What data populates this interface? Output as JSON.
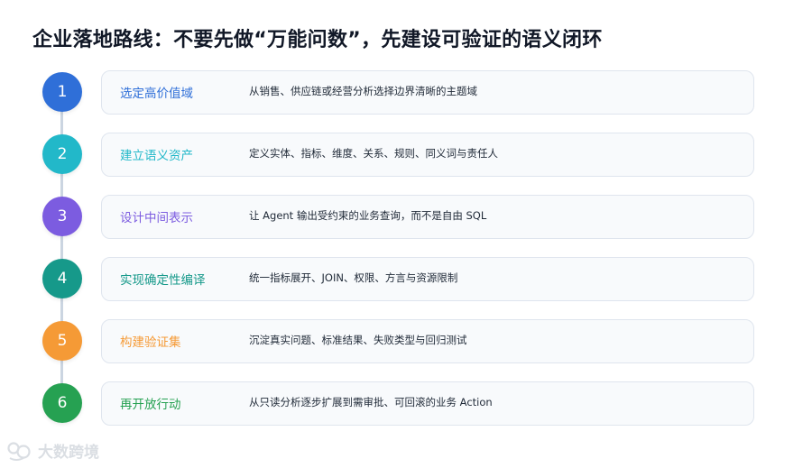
{
  "title": "企业落地路线：不要先做“万能问数”，先建设可验证的语义闭环",
  "steps": [
    {
      "number": "1",
      "title": "选定高价值域",
      "description": "从销售、供应链或经营分析选择边界清晰的主题域",
      "color": "#2f6fd8"
    },
    {
      "number": "2",
      "title": "建立语义资产",
      "description": "定义实体、指标、维度、关系、规则、同义词与责任人",
      "color": "#22b8c9"
    },
    {
      "number": "3",
      "title": "设计中间表示",
      "description": "让 Agent 输出受约束的业务查询，而不是自由 SQL",
      "color": "#7c5ce0"
    },
    {
      "number": "4",
      "title": "实现确定性编译",
      "description": "统一指标展开、JOIN、权限、方言与资源限制",
      "color": "#16998a"
    },
    {
      "number": "5",
      "title": "构建验证集",
      "description": "沉淀真实问题、标准结果、失败类型与回归测试",
      "color": "#f59a36"
    },
    {
      "number": "6",
      "title": "再开放行动",
      "description": "从只读分析逐步扩展到需审批、可回滚的业务 Action",
      "color": "#26a152"
    }
  ],
  "watermark": {
    "text": "大数跨境",
    "icon": "logo-icon"
  }
}
